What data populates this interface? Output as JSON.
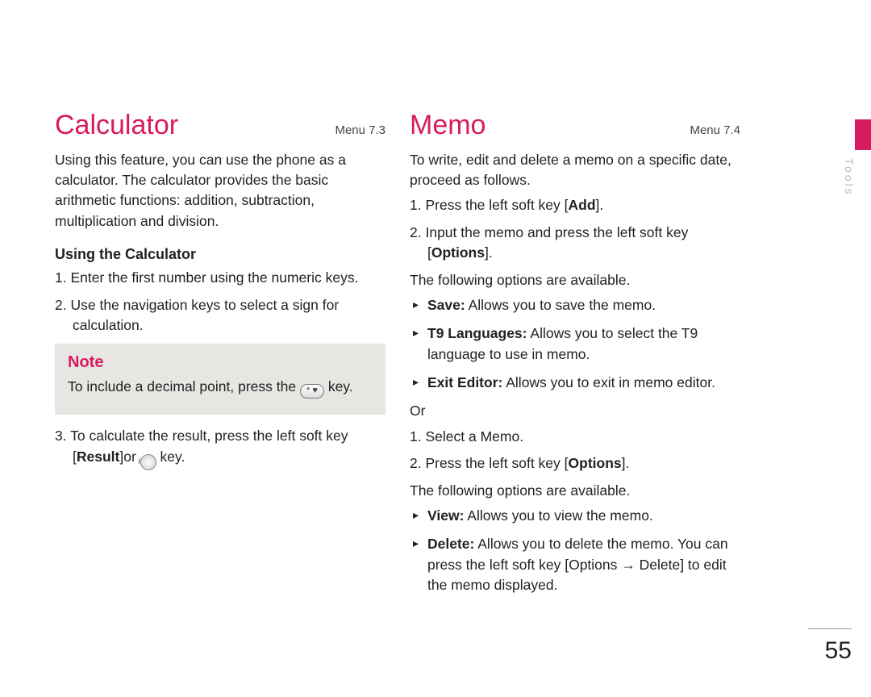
{
  "side": {
    "chapter": "Tools"
  },
  "page_number": "55",
  "left": {
    "title": "Calculator",
    "menu_ref": "Menu 7.3",
    "intro": "Using this feature, you can use the phone as a calculator. The calculator provides the basic arithmetic functions: addition, subtraction, multiplication and division.",
    "subhead": "Using the Calculator",
    "steps12": [
      {
        "n": "1.",
        "text": "Enter the first number using the numeric keys."
      },
      {
        "n": "2.",
        "text": "Use the navigation keys to select a sign for calculation."
      }
    ],
    "note": {
      "title": "Note",
      "before": "To include a decimal point, press the ",
      "key_glyph": "* ♥",
      "after": " key."
    },
    "step3": {
      "n": "3.",
      "before": "To calculate the result, press the left soft key [",
      "bold1": "Result",
      "mid": "]or  ",
      "round_glyph": "i",
      "after": " key."
    }
  },
  "right": {
    "title": "Memo",
    "menu_ref": "Menu 7.4",
    "intro": "To write, edit and delete a memo on a specific date, proceed as follows.",
    "stepsA": [
      {
        "n": "1.",
        "before": "Press the left soft key [",
        "bold": "Add",
        "after": "]."
      },
      {
        "n": "2.",
        "before": "Input the memo and press the left soft key [",
        "bold": "Options",
        "after": "]."
      }
    ],
    "options_intro": "The following options are available.",
    "optionsA": [
      {
        "bold": "Save:",
        "text": " Allows you to save the memo."
      },
      {
        "bold": "T9 Languages:",
        "text": " Allows you to select the T9 language to use in memo."
      },
      {
        "bold": "Exit Editor:",
        "text": " Allows you to exit in memo editor."
      }
    ],
    "or": "Or",
    "stepsB": [
      {
        "n": "1.",
        "text": "Select a Memo."
      },
      {
        "n": "2.",
        "before": "Press the left soft key [",
        "bold": "Options",
        "after": "]."
      }
    ],
    "options_intro2": "The following options are available.",
    "optionsB": [
      {
        "bold": "View:",
        "text": " Allows you to view the memo."
      },
      {
        "bold": "Delete:",
        "text": " Allows you to delete the memo. You can press the left soft key [Options → Delete] to edit the memo displayed."
      }
    ]
  }
}
